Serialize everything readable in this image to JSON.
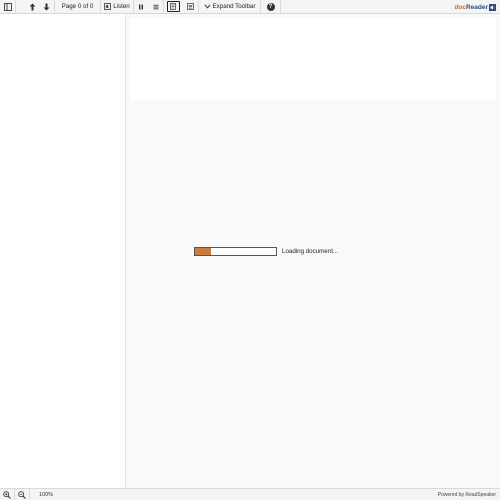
{
  "toolbar": {
    "page_indicator": "Page 0 of 0",
    "listen_label": "Listen",
    "expand_label": "Expand Toolbar",
    "help_glyph": "?",
    "brand_prefix": "doc",
    "brand_suffix": "Reader",
    "icons": [
      "sidebar-toggle-icon",
      "arrow-up-icon",
      "arrow-down-icon",
      "listen-icon",
      "pause-icon",
      "menu-lines-icon",
      "text-mode-icon",
      "page-mode-icon",
      "chevron-down-icon",
      "help-icon"
    ]
  },
  "main": {
    "loading_text": "Loading document...",
    "progress_fraction": 0.2,
    "colors": {
      "progress": "#cd7a3d",
      "background": "#f8f9fa",
      "brand_orange": "#d26a12",
      "brand_blue": "#2b4a8b"
    }
  },
  "bottombar": {
    "zoom_level": "100%",
    "powered_by": "Powered by ReadSpeaker",
    "icons": [
      "zoom-in-icon",
      "zoom-out-icon"
    ]
  }
}
